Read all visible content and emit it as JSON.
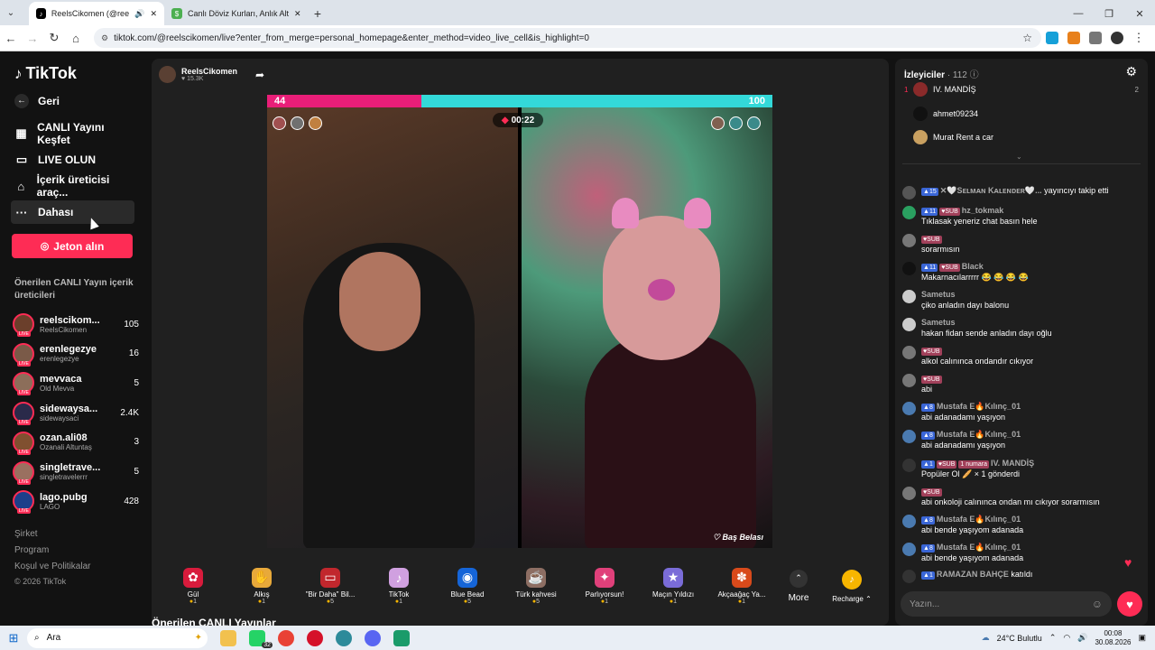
{
  "browser": {
    "tabs": [
      {
        "title": "ReelsCikomen (@reelscikom",
        "active": true
      },
      {
        "title": "Canlı Döviz Kurları, Anlık Altın F",
        "active": false
      }
    ],
    "url": "tiktok.com/@reelscikomen/live?enter_from_merge=personal_homepage&enter_method=video_live_cell&is_highlight=0"
  },
  "sidebar": {
    "logo": "TikTok",
    "back": "Geri",
    "nav": [
      {
        "label": "CANLI Yayını Keşfet",
        "icon": "live-explore-icon"
      },
      {
        "label": "LIVE OLUN",
        "icon": "camera-icon"
      },
      {
        "label": "İçerik üreticisi araç...",
        "icon": "home-creator-icon"
      },
      {
        "label": "Dahası",
        "icon": "more-icon"
      }
    ],
    "jeton_button": "Jeton alın",
    "section_title": "Önerilen CANLI Yayın içerik üreticileri",
    "creators": [
      {
        "name": "reelscikom...",
        "sub": "ReelsCikomen",
        "count": "105",
        "color": "#6b3f2b"
      },
      {
        "name": "erenlegezye",
        "sub": "erenlegezye",
        "count": "16",
        "color": "#7a5a48"
      },
      {
        "name": "mevvaca",
        "sub": "Old Mevva",
        "count": "5",
        "color": "#8c6e5a"
      },
      {
        "name": "sidewaysa...",
        "sub": "sidewaysaci",
        "count": "2.4K",
        "color": "#2a2a4a"
      },
      {
        "name": "ozan.ali08",
        "sub": "Ozanali Altuntaş",
        "count": "3",
        "color": "#805030"
      },
      {
        "name": "singletrave...",
        "sub": "singletravelerrr",
        "count": "5",
        "color": "#9a7060"
      },
      {
        "name": "lago.pubg",
        "sub": "LAGO",
        "count": "428",
        "color": "#1d3f8a"
      }
    ],
    "footer": [
      "Şirket",
      "Program",
      "Koşul ve Politikalar",
      "© 2026 TikTok"
    ]
  },
  "stream": {
    "host_name": "ReelsCikomen",
    "host_likes": "15.3K",
    "battle_left": "44",
    "battle_right": "100",
    "battle_left_fraction": 0.306,
    "timer": "00:22",
    "watermark": "Baş Belası",
    "gifts": [
      {
        "name": "Gül",
        "price": "1",
        "color": "#d81b3c",
        "glyph": "✿"
      },
      {
        "name": "Alkış",
        "price": "1",
        "color": "#e8a93a",
        "glyph": "✋"
      },
      {
        "name": "\"Bir Daha\" Bil...",
        "price": "5",
        "color": "#c1272d",
        "glyph": "▭"
      },
      {
        "name": "TikTok",
        "price": "1",
        "color": "#d0a0e0",
        "glyph": "♪"
      },
      {
        "name": "Blue Bead",
        "price": "5",
        "color": "#1565d8",
        "glyph": "◉"
      },
      {
        "name": "Türk kahvesi",
        "price": "5",
        "color": "#8d6e63",
        "glyph": "☕"
      },
      {
        "name": "Parlıyorsun!",
        "price": "1",
        "color": "#e0407a",
        "glyph": "✦"
      },
      {
        "name": "Maçın Yıldızı",
        "price": "1",
        "color": "#7a6cd8",
        "glyph": "★"
      },
      {
        "name": "Akçaağaç Ya...",
        "price": "1",
        "color": "#d84a1b",
        "glyph": "✽"
      }
    ],
    "more_label": "More",
    "recharge_label": "Recharge",
    "recommend_heading": "Önerilen CANLI Yayınlar"
  },
  "chat": {
    "viewers_label": "İzleyiciler",
    "viewers_count": "· 112",
    "top_viewers": [
      {
        "rank": "1",
        "name": "IV. MANDİŞ",
        "right": "2",
        "color": "#8a2a2a"
      },
      {
        "rank": "",
        "name": "ahmet09234",
        "right": "",
        "color": "#111"
      },
      {
        "rank": "",
        "name": "Murat Rent a car",
        "right": "",
        "color": "#c9a060"
      }
    ],
    "messages": [
      {
        "badges": [
          "15"
        ],
        "sub": false,
        "user": "✕🤍Sᴇʟᴍᴀɴ Kᴀʟᴇɴᴅᴇʀ🤍...",
        "text": "yayıncıyı takip etti",
        "inline": true,
        "color": "#555"
      },
      {
        "badges": [
          "11"
        ],
        "sub": true,
        "user": "hz_tokmak",
        "text": "Tıklasak yeneriz chat basın hele",
        "inline": false,
        "color": "#2aa060"
      },
      {
        "badges": [],
        "sub": true,
        "user": "",
        "text": "sorarmısın",
        "inline": false,
        "color": "#777"
      },
      {
        "badges": [
          "11"
        ],
        "sub": true,
        "user": "Black",
        "text": "Makarnacılarrrrr 😂 😂 😂 😂",
        "inline": false,
        "color": "#111"
      },
      {
        "badges": [],
        "sub": false,
        "user": "Sametus",
        "text": "çiko anladın dayı balonu",
        "inline": false,
        "color": "#ccc"
      },
      {
        "badges": [],
        "sub": false,
        "user": "Sametus",
        "text": "hakan fidan sende anladın dayı oğlu",
        "inline": false,
        "color": "#ccc"
      },
      {
        "badges": [],
        "sub": true,
        "user": "",
        "text": "alkol calınınca ondandır cıkıyor",
        "inline": false,
        "color": "#777"
      },
      {
        "badges": [],
        "sub": true,
        "user": "",
        "text": "abi",
        "inline": false,
        "color": "#777"
      },
      {
        "badges": [
          "8"
        ],
        "sub": false,
        "user": "Mustafa E🔥Kılınç_01",
        "text": "abi adanadamı yaşıyon",
        "inline": false,
        "color": "#4a7ab0"
      },
      {
        "badges": [
          "8"
        ],
        "sub": false,
        "user": "Mustafa E🔥Kılınç_01",
        "text": "abi adanadamı yaşıyon",
        "inline": false,
        "color": "#4a7ab0"
      },
      {
        "badges": [
          "1"
        ],
        "sub": true,
        "user": "IV. MANDİŞ",
        "text": "Popüler Ol 🥖 × 1 gönderdi",
        "inline": false,
        "color": "#333",
        "extra": "1 numara"
      },
      {
        "badges": [],
        "sub": true,
        "user": "",
        "text": "abi onkoloji calınınca ondan mı cıkıyor sorarmısın",
        "inline": false,
        "color": "#777"
      },
      {
        "badges": [
          "8"
        ],
        "sub": false,
        "user": "Mustafa E🔥Kılınç_01",
        "text": "abi bende yaşıyom adanada",
        "inline": false,
        "color": "#4a7ab0"
      },
      {
        "badges": [
          "8"
        ],
        "sub": false,
        "user": "Mustafa E🔥Kılınç_01",
        "text": "abi bende yaşıyom adanada",
        "inline": false,
        "color": "#4a7ab0"
      },
      {
        "badges": [
          "1"
        ],
        "sub": false,
        "user": "RAMAZAN BAHÇE",
        "text": "katıldı",
        "inline": true,
        "color": "#333"
      }
    ],
    "input_placeholder": "Yazın..."
  },
  "taskbar": {
    "search": "Ara",
    "weather": "24°C Bulutlu",
    "time": "00:08",
    "date": "30.08.2026",
    "badge": "32"
  }
}
